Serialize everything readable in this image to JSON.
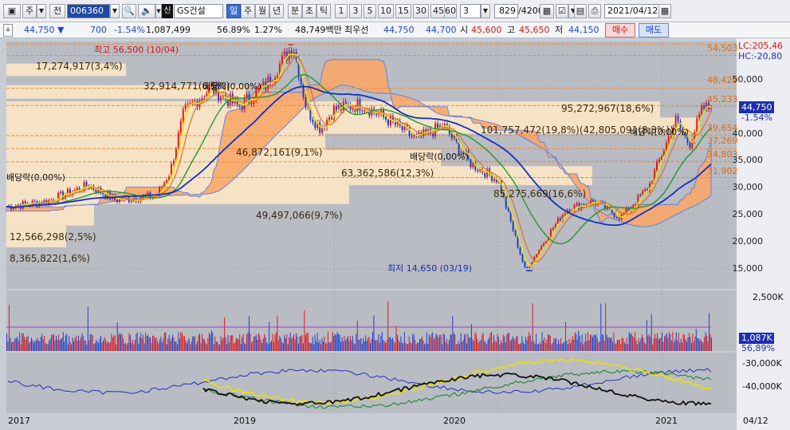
{
  "toolbar": {
    "market_btn": "주",
    "jeon_btn": "전",
    "code": "006360",
    "stock_name": "GS건설",
    "sin_badge": "신",
    "period_tabs": [
      "일",
      "주",
      "월",
      "년",
      "분",
      "초",
      "틱"
    ],
    "interval_tabs": [
      "1",
      "3",
      "5",
      "10",
      "15",
      "30",
      "45",
      "60"
    ],
    "interval_sel": "3",
    "count": "829",
    "count_total": "/4200",
    "date": "2021/04/12"
  },
  "quote": {
    "price": "44,750",
    "change_arrow": "▼",
    "change": "700",
    "change_pct": "-1.54%",
    "volume": "1,087,499",
    "vol_ratio": "56.89%",
    "turnover": "1.27%",
    "amount": "48,749백만",
    "best_ask_label": "최우선",
    "ask": "44,750",
    "bid": "44,700",
    "open_label": "시",
    "open": "45,600",
    "high_label": "고",
    "high": "45,650",
    "low_label": "저",
    "low": "44,150",
    "buy_btn": "매수",
    "sell_btn": "매도"
  },
  "chart_data": {
    "type": "line",
    "title": "GS건설 (006360) 일봉",
    "x_axis": [
      "2017",
      "2019",
      "2020",
      "2021",
      "04/12"
    ],
    "y_axis": [
      "50,000",
      "45,000",
      "40,000",
      "35,000",
      "30,000",
      "25,000",
      "20,000",
      "15,000"
    ],
    "ylim": [
      12000,
      57000
    ],
    "price_path": [
      [
        "2017-01",
        26500
      ],
      [
        "2017-04",
        27500
      ],
      [
        "2017-07",
        30500
      ],
      [
        "2017-09",
        27800
      ],
      [
        "2017-12",
        28500
      ],
      [
        "2018-01",
        33000
      ],
      [
        "2018-02",
        44000
      ],
      [
        "2018-04",
        48500
      ],
      [
        "2018-06",
        45000
      ],
      [
        "2018-08",
        49000
      ],
      [
        "2018-10",
        56500
      ],
      [
        "2018-11",
        44500
      ],
      [
        "2018-12",
        41000
      ],
      [
        "2019-01",
        44500
      ],
      [
        "2019-03",
        45500
      ],
      [
        "2019-05",
        42500
      ],
      [
        "2019-07",
        39000
      ],
      [
        "2019-09",
        41500
      ],
      [
        "2019-11",
        34500
      ],
      [
        "2020-01",
        31500
      ],
      [
        "2020-03",
        14650
      ],
      [
        "2020-05",
        22500
      ],
      [
        "2020-06",
        26000
      ],
      [
        "2020-08",
        27500
      ],
      [
        "2020-10",
        24500
      ],
      [
        "2020-12",
        30000
      ],
      [
        "2021-02",
        42500
      ],
      [
        "2021-03",
        38000
      ],
      [
        "2021-04",
        44750
      ]
    ],
    "volume_profile": [
      {
        "value": "17,274,917(3,4%)"
      },
      {
        "value": "32,914,771(6,5%)"
      },
      {
        "value": "95,272,967(18,6%)"
      },
      {
        "value": "101,757,472(19,8%)(42,805,091(8,3%))"
      },
      {
        "value": "46,872,161(9,1%)"
      },
      {
        "value": "63,362,586(12,3%)"
      },
      {
        "value": "85,275,669(16,6%)"
      },
      {
        "value": "49,497,066(9,7%)"
      },
      {
        "value": "12,566,298(2,5%)"
      },
      {
        "value": "8,365,822(1,6%)"
      }
    ],
    "hline_labels": [
      "54,503",
      "48,429",
      "45,233",
      "39,654",
      "37,269",
      "34,803",
      "31,902"
    ],
    "annotations": {
      "high": "최고 56,500 (10/04)",
      "low": "최저 14,650 (03/19)",
      "div1": "배당락(0,00%)",
      "div2": "배당락(0,00%)",
      "div3": "배당락(0,00%)",
      "div4": "배당락(0,00%)",
      "lc": "LC:205,46",
      "hc": "HC:-20,80"
    },
    "current_price_tag": {
      "price": "44,750",
      "pct": "-1.54%"
    },
    "volume_axis": [
      "2,500K"
    ],
    "volume_tag": {
      "value": "1,087K",
      "pct": "56,89%"
    },
    "obv_axis": [
      "-30,000K",
      "-40,000K"
    ]
  }
}
